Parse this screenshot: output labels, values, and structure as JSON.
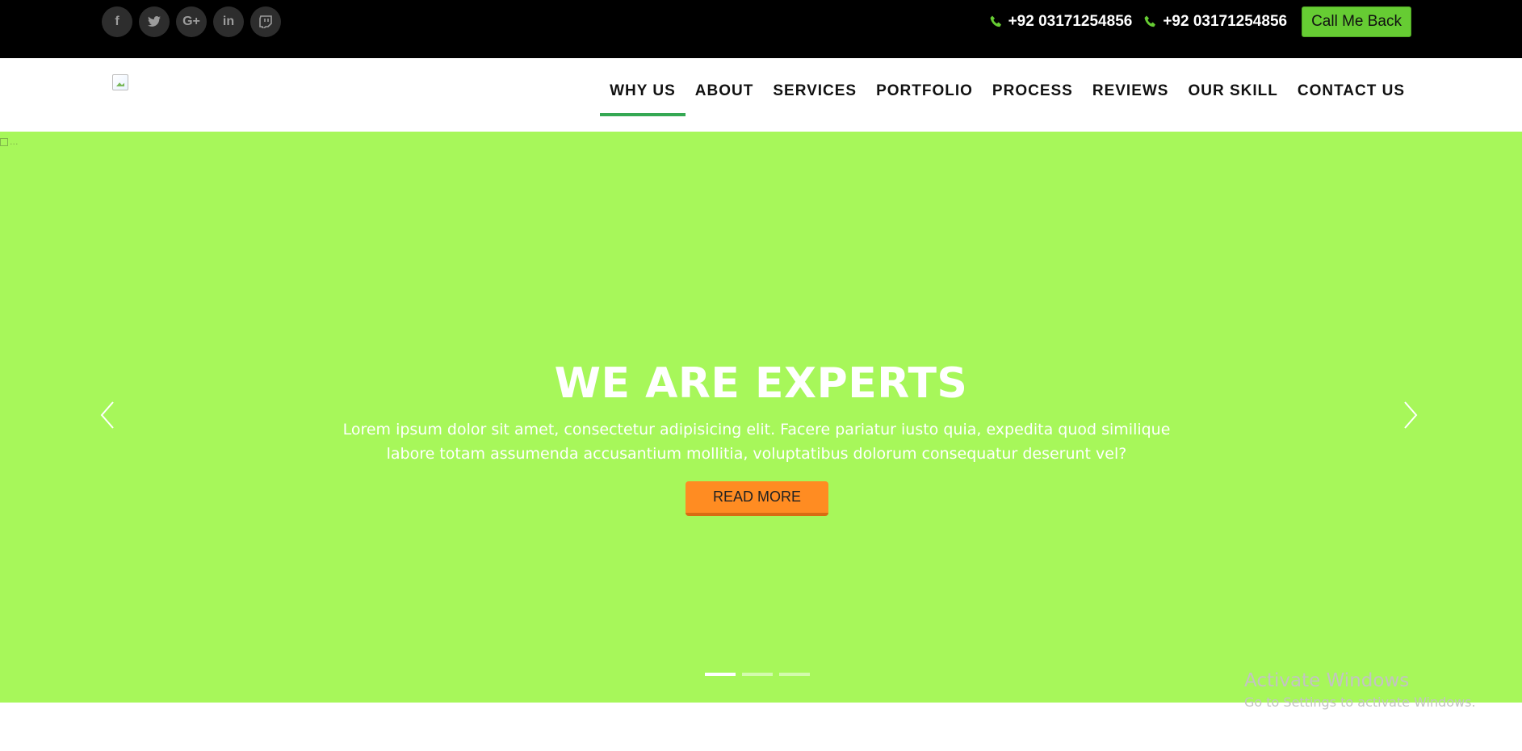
{
  "topbar": {
    "social": [
      {
        "icon": "facebook-icon",
        "glyph": "f"
      },
      {
        "icon": "twitter-icon",
        "glyph": "t"
      },
      {
        "icon": "google-plus-icon",
        "glyph": "G+"
      },
      {
        "icon": "linkedin-icon",
        "glyph": "in"
      },
      {
        "icon": "twitch-icon",
        "glyph": "◘"
      }
    ],
    "phones": [
      "+92 03171254856",
      "+92 03171254856"
    ],
    "call_button": "Call Me Back"
  },
  "nav": {
    "items": [
      "WHY US",
      "ABOUT",
      "SERVICES",
      "PORTFOLIO",
      "PROCESS",
      "REVIEWS",
      "OUR SKILL",
      "CONTACT US"
    ],
    "active_index": 0,
    "active_color": "#35a853"
  },
  "hero": {
    "broken_image_alt": "...",
    "title": "WE ARE EXPERTS",
    "text": "Lorem ipsum dolor sit amet, consectetur adipisicing elit. Facere pariatur iusto quia, expedita quod similique labore totam assumenda accusantium mollitia, voluptatibus dolorum consequatur deserunt vel?",
    "button": "READ MORE",
    "background_color": "#a7f75a",
    "button_color": "#ff8c22",
    "slide_count": 3,
    "active_slide": 1
  },
  "watermark": {
    "title": "Activate Windows",
    "subtitle": "Go to Settings to activate Windows."
  },
  "colors": {
    "topbar": "#000000",
    "call_button": "#66cc33"
  }
}
